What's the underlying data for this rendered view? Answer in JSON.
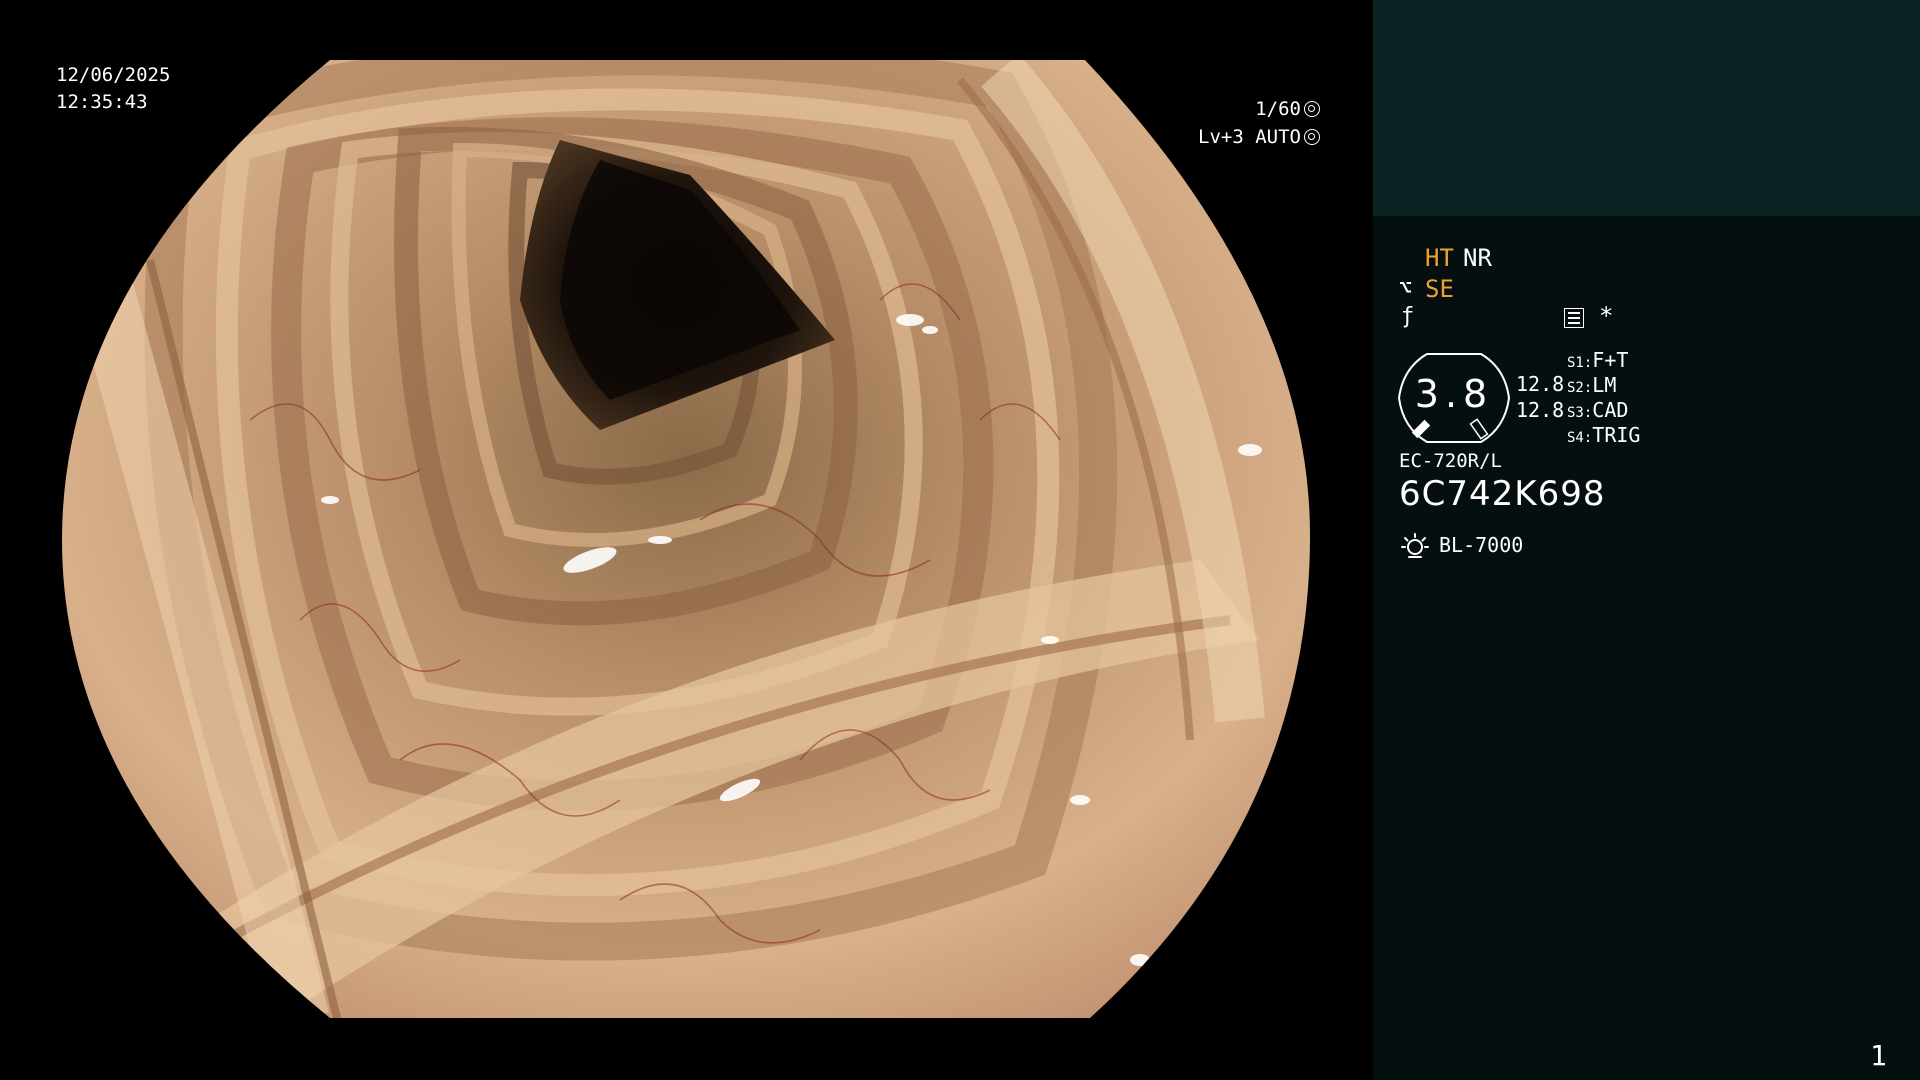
{
  "video": {
    "date": "12/06/2025",
    "time": "12:35:43",
    "shutter": "1/60",
    "gain_mode": "Lv+3 AUTO",
    "shutter_icon": "aperture-icon",
    "gain_icon": "auto-iris-icon"
  },
  "panel": {
    "mode_ht": "HT",
    "mode_nr": "NR",
    "se_icon": "scope-tip-icon",
    "se_label": "SE",
    "freeze_icon": "function-icon",
    "menu_icon": "menu-icon",
    "star": "*",
    "zoom_value": "3.8",
    "value_1": "12.8",
    "value_2": "12.8",
    "switches": [
      {
        "key": "S1:",
        "value": "F+T"
      },
      {
        "key": "S2:",
        "value": "LM"
      },
      {
        "key": "S3:",
        "value": "CAD"
      },
      {
        "key": "S4:",
        "value": "TRIG"
      }
    ],
    "scope_model": "EC-720R/L",
    "serial": "6C742K698",
    "light_icon": "light-source-icon",
    "light_model": "BL-7000",
    "page_number": "1"
  },
  "colors": {
    "accent_orange": "#f0a030",
    "panel_bg": "#060f0f",
    "panel_top_bg": "#0b2323"
  }
}
